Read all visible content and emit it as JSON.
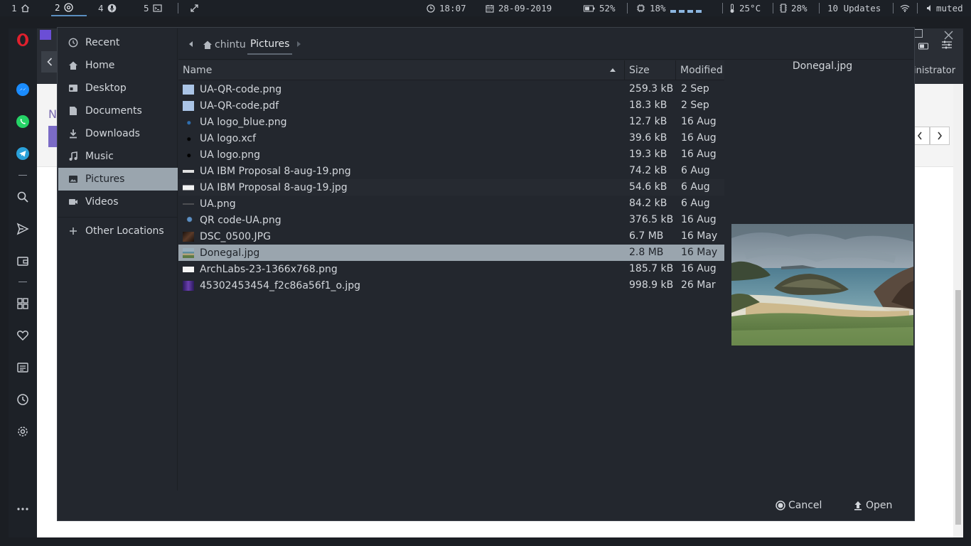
{
  "topbar": {
    "workspaces": [
      {
        "num": "1",
        "icon": "home-icon"
      },
      {
        "num": "2",
        "icon": "chrome-icon"
      },
      {
        "num": "4",
        "icon": "mic-icon"
      },
      {
        "num": "5",
        "icon": "terminal-icon"
      }
    ],
    "clock": "18:07",
    "date": "28-09-2019",
    "battery": "52%",
    "cpu": "18%",
    "temperature": "25°C",
    "memory": "28%",
    "updates": "10 Updates",
    "volume": "muted"
  },
  "browser": {
    "partial_heading": "N",
    "partial_user": "inistrator"
  },
  "dialog": {
    "places": [
      {
        "label": "Recent",
        "icon": "clock-icon"
      },
      {
        "label": "Home",
        "icon": "home-icon"
      },
      {
        "label": "Desktop",
        "icon": "desktop-icon"
      },
      {
        "label": "Documents",
        "icon": "document-icon"
      },
      {
        "label": "Downloads",
        "icon": "download-icon"
      },
      {
        "label": "Music",
        "icon": "music-icon"
      },
      {
        "label": "Pictures",
        "icon": "image-icon",
        "selected": true
      },
      {
        "label": "Videos",
        "icon": "video-icon"
      },
      {
        "label": "Other Locations",
        "icon": "plus-icon"
      }
    ],
    "pathbar": {
      "home": "chintu",
      "current": "Pictures"
    },
    "columns": {
      "name": "Name",
      "size": "Size",
      "modified": "Modified"
    },
    "files": [
      {
        "name": "UA-QR-code.png",
        "size": "259.3 kB",
        "modified": "2 Sep",
        "thumb": "#aac4e6"
      },
      {
        "name": "UA-QR-code.pdf",
        "size": "18.3 kB",
        "modified": "2 Sep",
        "thumb": "#aac4e6"
      },
      {
        "name": "UA logo_blue.png",
        "size": "12.7 kB",
        "modified": "16 Aug",
        "thumb": "#2f6fb0"
      },
      {
        "name": "UA logo.xcf",
        "size": "39.6 kB",
        "modified": "16 Aug",
        "thumb": "#111111"
      },
      {
        "name": "UA logo.png",
        "size": "19.3 kB",
        "modified": "16 Aug",
        "thumb": "#111111"
      },
      {
        "name": "UA IBM Proposal 8-aug-19.png",
        "size": "74.2 kB",
        "modified": "6 Aug",
        "thumb": "#e0e0e0"
      },
      {
        "name": "UA IBM Proposal 8-aug-19.jpg",
        "size": "54.6 kB",
        "modified": "6 Aug",
        "thumb": "#f2f2f2"
      },
      {
        "name": "UA.png",
        "size": "84.2 kB",
        "modified": "6 Aug",
        "thumb": "#555555"
      },
      {
        "name": "QR code-UA.png",
        "size": "376.5 kB",
        "modified": "16 Aug",
        "thumb": "#5b8fc4"
      },
      {
        "name": "DSC_0500.JPG",
        "size": "6.7 MB",
        "modified": "16 May",
        "thumb": "#3a2a20"
      },
      {
        "name": "Donegal.jpg",
        "size": "2.8 MB",
        "modified": "16 May",
        "thumb": "#6f8fa0",
        "selected": true
      },
      {
        "name": "ArchLabs-23-1366x768.png",
        "size": "185.7 kB",
        "modified": "16 Aug",
        "thumb": "#f4f4f4"
      },
      {
        "name": "45302453454_f2c86a56f1_o.jpg",
        "size": "998.9 kB",
        "modified": "26 Mar",
        "thumb": "#4b2a8a"
      }
    ],
    "preview": {
      "title": "Donegal.jpg"
    },
    "buttons": {
      "cancel": "Cancel",
      "open": "Open"
    }
  }
}
